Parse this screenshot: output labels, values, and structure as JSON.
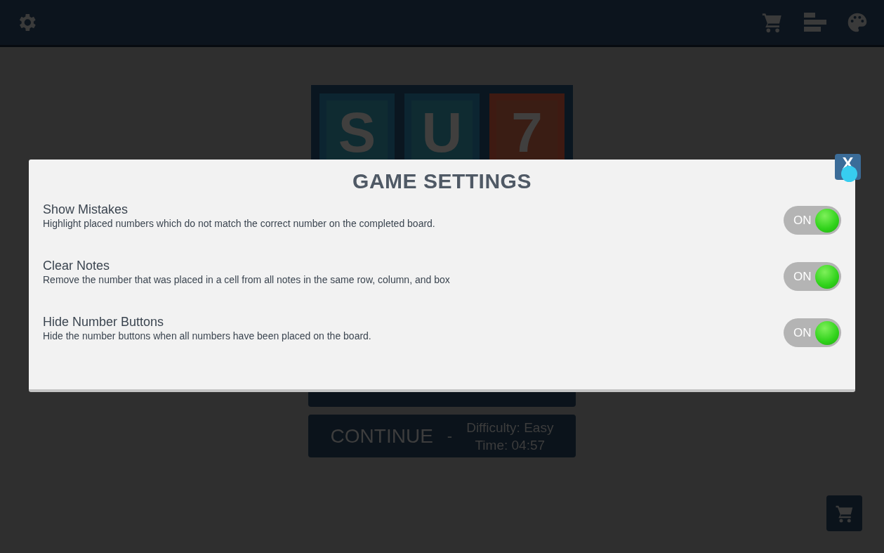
{
  "logo": {
    "tiles": [
      {
        "letter": "S",
        "color": "#0f2b31"
      },
      {
        "letter": "U",
        "color": "#0f2b31"
      },
      {
        "letter": "7",
        "color": "#3a1d14"
      }
    ]
  },
  "menu": {
    "continue": {
      "label": "CONTINUE",
      "separator": "-",
      "difficulty": "Difficulty: Easy",
      "time": "Time: 04:57"
    }
  },
  "dialog": {
    "title": "GAME SETTINGS",
    "close_label": "X",
    "settings": [
      {
        "name": "Show Mistakes",
        "description": "Highlight placed numbers which do not match the correct number on the completed board.",
        "toggle": {
          "on": true,
          "label": "ON"
        }
      },
      {
        "name": "Clear Notes",
        "description": "Remove the number that was placed in a cell from all notes in the same row, column, and box",
        "toggle": {
          "on": true,
          "label": "ON"
        }
      },
      {
        "name": "Hide Number Buttons",
        "description": "Hide the number buttons when all numbers have been placed on the board.",
        "toggle": {
          "on": true,
          "label": "ON"
        }
      }
    ]
  }
}
